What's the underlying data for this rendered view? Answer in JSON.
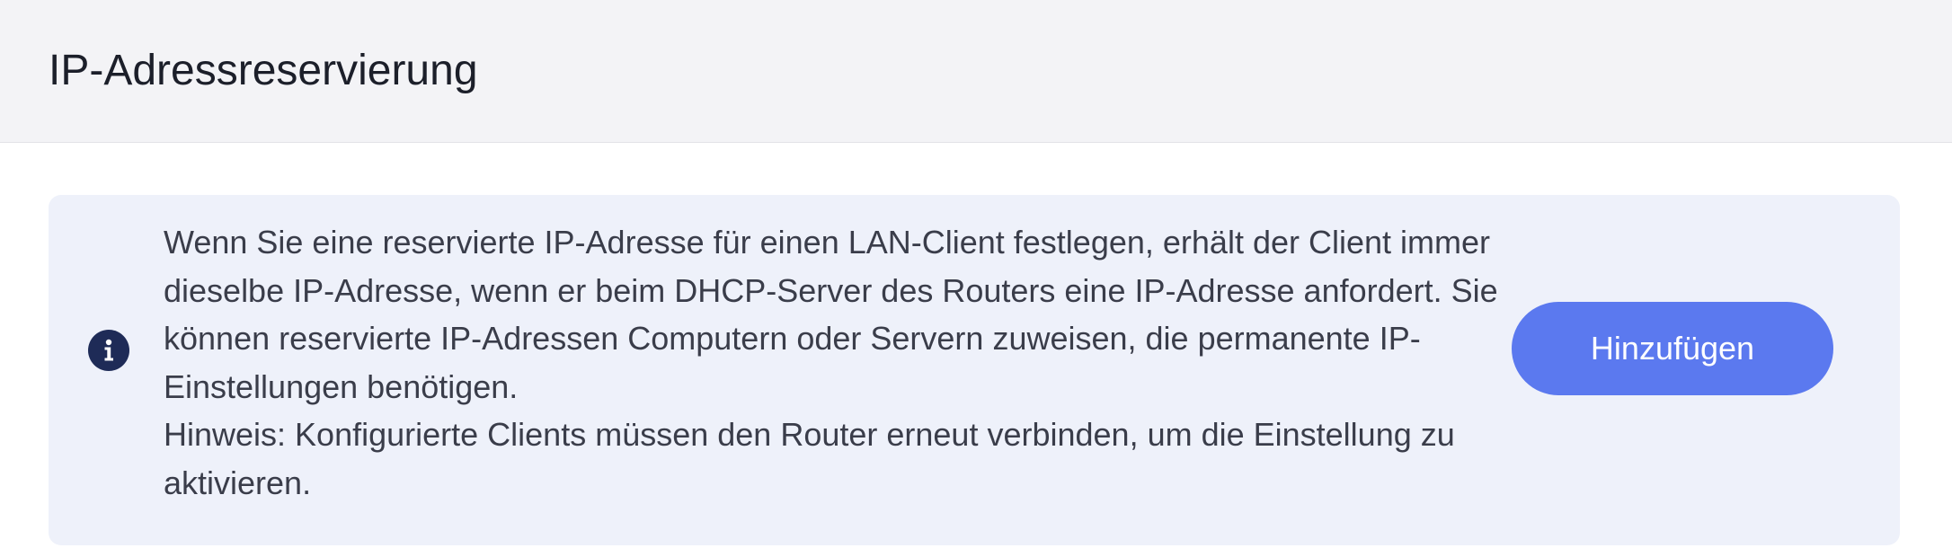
{
  "header": {
    "title": "IP-Adressreservierung"
  },
  "notice": {
    "icon": "info-icon",
    "paragraph": "Wenn Sie eine reservierte IP-Adresse für einen LAN-Client festlegen, erhält der Client immer dieselbe IP-Adresse, wenn er beim DHCP-Server des Routers eine IP-Adresse anfordert. Sie können reservierte IP-Adressen Computern oder Servern zuweisen, die permanente IP-Einstellungen benötigen.",
    "hint": "Hinweis: Konfigurierte Clients müssen den Router erneut verbinden, um die Einstellung zu aktivieren."
  },
  "actions": {
    "add_label": "Hinzufügen"
  },
  "colors": {
    "header_bg": "#f3f3f6",
    "notice_bg": "#eef1fa",
    "accent": "#5b79ef",
    "icon_bg": "#1e2b57"
  }
}
